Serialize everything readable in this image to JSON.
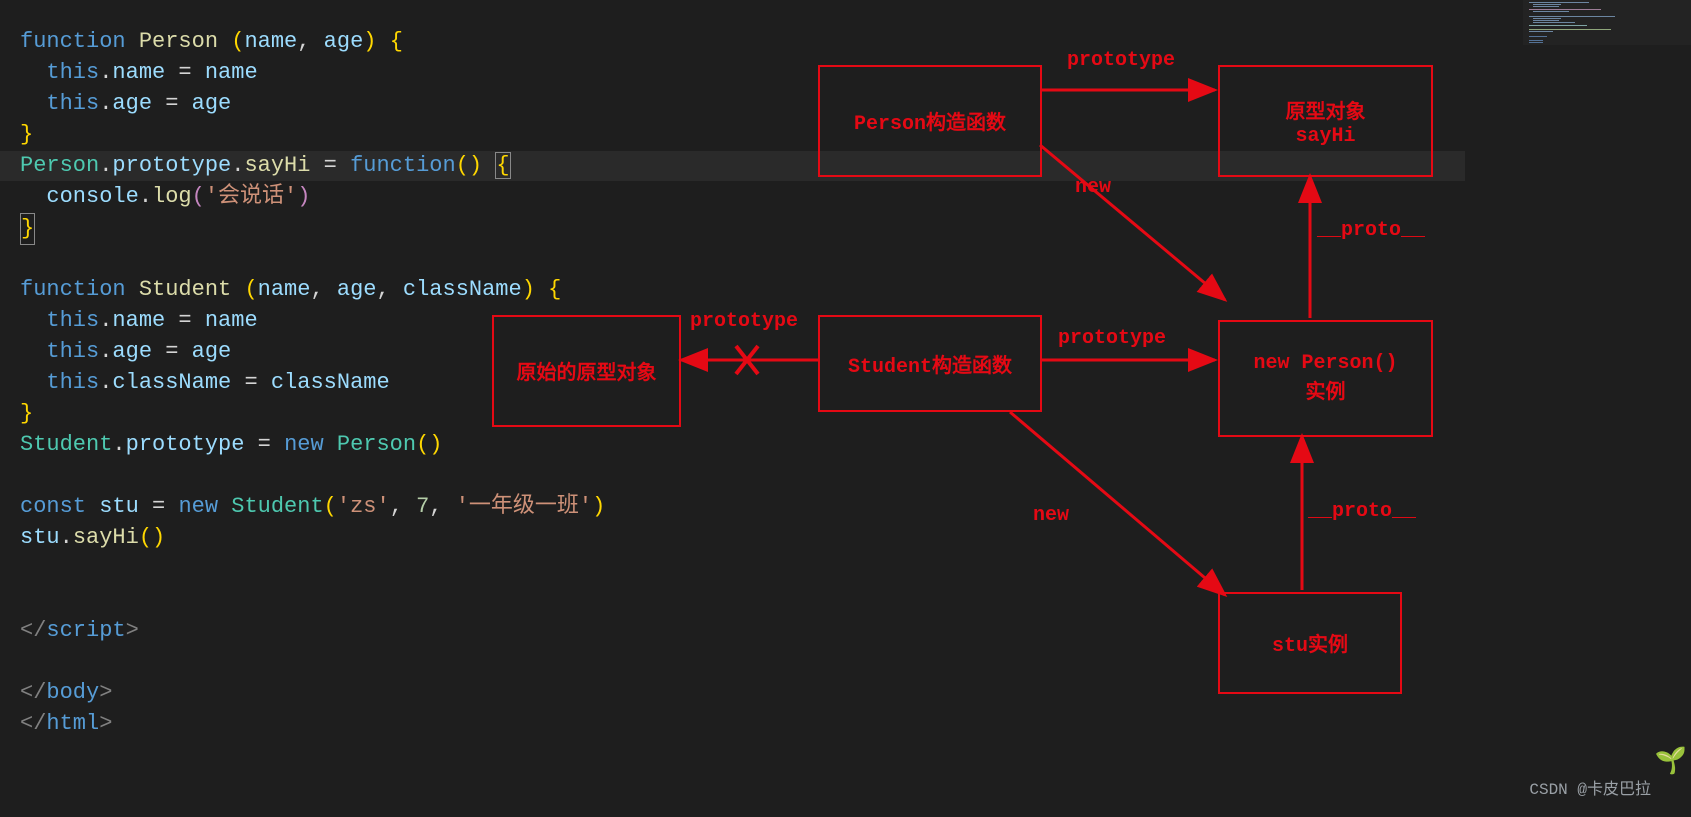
{
  "code": {
    "l1": {
      "a": "function ",
      "b": "Person ",
      "c": "(",
      "d": "name",
      "e": ", ",
      "f": "age",
      "g": ") ",
      "h": "{"
    },
    "l2": {
      "a": "  ",
      "b": "this",
      "c": ".",
      "d": "name",
      "e": " = ",
      "f": "name"
    },
    "l3": {
      "a": "  ",
      "b": "this",
      "c": ".",
      "d": "age",
      "e": " = ",
      "f": "age"
    },
    "l4": "}",
    "l5": {
      "a": "Person",
      "b": ".",
      "c": "prototype",
      "d": ".",
      "e": "sayHi",
      "f": " = ",
      "g": "function",
      "h": "() ",
      "i": "{"
    },
    "l6": {
      "a": "  ",
      "b": "console",
      "c": ".",
      "d": "log",
      "e": "(",
      "f": "'会说话'",
      "g": ")"
    },
    "l7": "}",
    "l9": {
      "a": "function ",
      "b": "Student ",
      "c": "(",
      "d": "name",
      "e": ", ",
      "f": "age",
      "g": ", ",
      "h": "className",
      "i": ") ",
      "j": "{"
    },
    "l10": {
      "a": "  ",
      "b": "this",
      "c": ".",
      "d": "name",
      "e": " = ",
      "f": "name"
    },
    "l11": {
      "a": "  ",
      "b": "this",
      "c": ".",
      "d": "age",
      "e": " = ",
      "f": "age"
    },
    "l12": {
      "a": "  ",
      "b": "this",
      "c": ".",
      "d": "className",
      "e": " = ",
      "f": "className"
    },
    "l13": "}",
    "l14": {
      "a": "Student",
      "b": ".",
      "c": "prototype",
      "d": " = ",
      "e": "new ",
      "f": "Person",
      "g": "()"
    },
    "l16": {
      "a": "const ",
      "b": "stu",
      "c": " = ",
      "d": "new ",
      "e": "Student",
      "f": "(",
      "g": "'zs'",
      "h": ", ",
      "i": "7",
      "j": ", ",
      "k": "'一年级一班'",
      "l": ")"
    },
    "l17": {
      "a": "stu",
      "b": ".",
      "c": "sayHi",
      "d": "()"
    },
    "l20": {
      "a": "</",
      "b": "script",
      "c": ">"
    },
    "l22": {
      "a": "</",
      "b": "body",
      "c": ">"
    },
    "l23": {
      "a": "</",
      "b": "html",
      "c": ">"
    }
  },
  "diagram": {
    "boxes": {
      "person": "Person构造函数",
      "proto_obj": "原型对象\nsayHi",
      "orig_proto": "原始的原型对象",
      "student": "Student构造函数",
      "new_person": "new Person()\n实例",
      "stu": "stu实例"
    },
    "labels": {
      "proto1": "prototype",
      "new1": "new",
      "proto_left": "prototype",
      "proto2": "prototype",
      "proto_u1": "__proto__",
      "new2": "new",
      "proto_u2": "__proto__"
    }
  },
  "watermark": "CSDN @卡皮巴拉"
}
